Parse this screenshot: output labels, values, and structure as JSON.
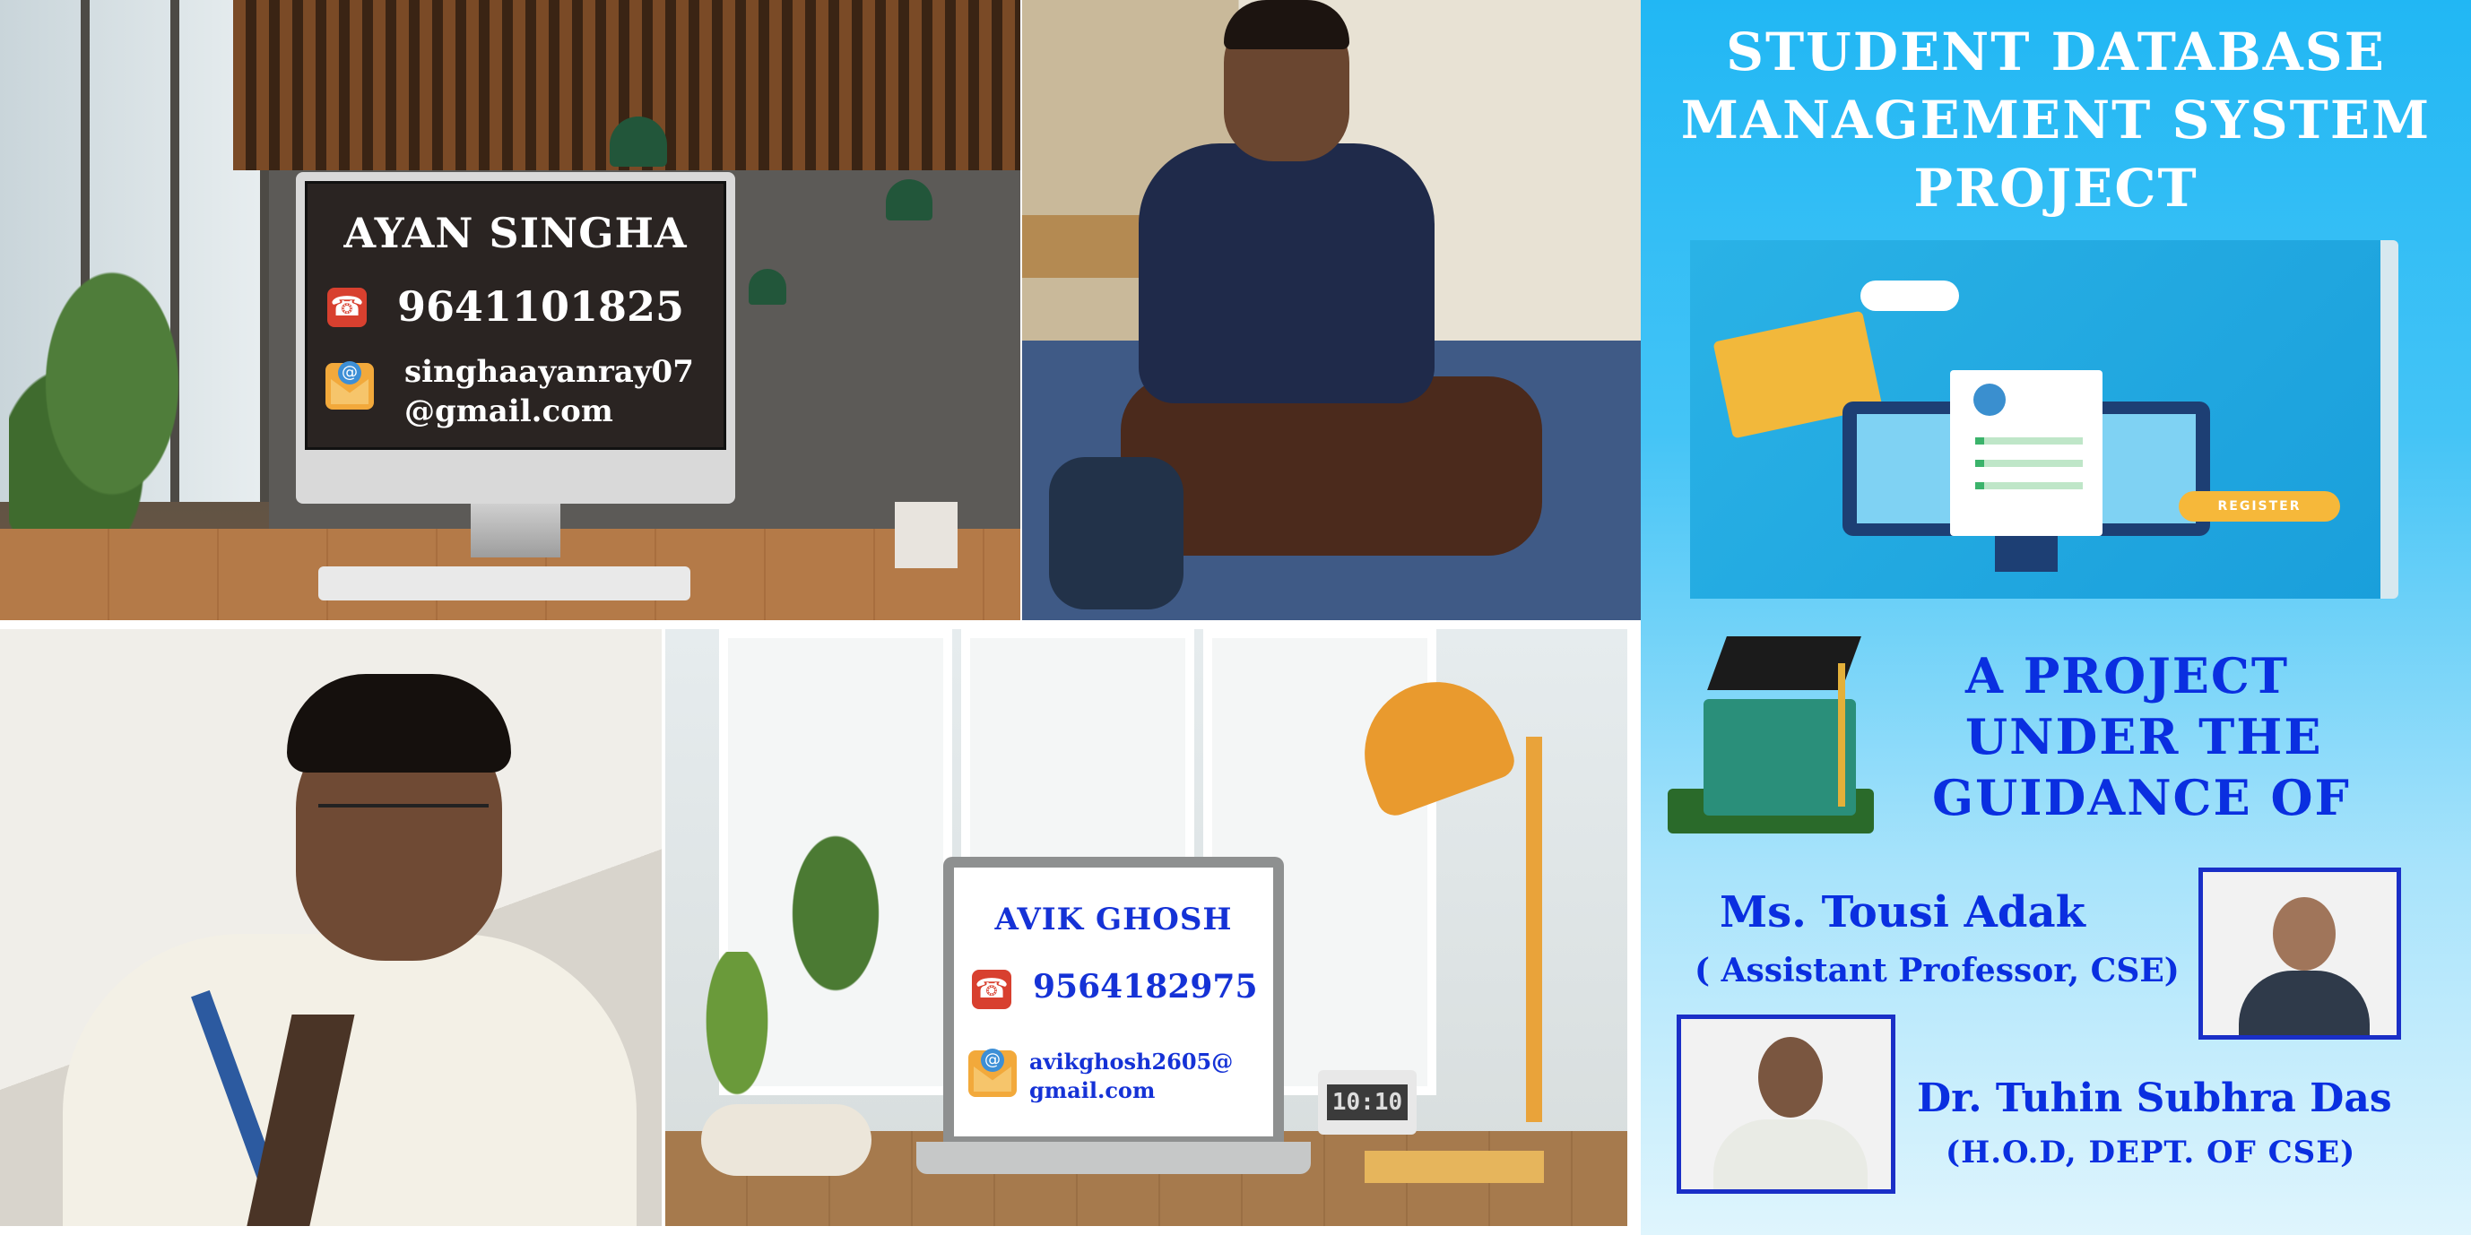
{
  "cards": {
    "ayan": {
      "name": "AYAN SINGHA",
      "phone": "9641101825",
      "email_line1": "singhaayanray07",
      "email_line2": "@gmail.com"
    },
    "avik": {
      "name": "AVIK  GHOSH",
      "phone": "9564182975",
      "email_line1": "avikghosh2605@",
      "email_line2": "gmail.com"
    }
  },
  "clock_text": "10:10",
  "project": {
    "title_line1": "STUDENT  DATABASE",
    "title_line2": "MANAGEMENT  SYSTEM",
    "title_line3": "PROJECT",
    "register_label": "REGISTER",
    "guidance_line1": "A PROJECT",
    "guidance_line2": "UNDER  THE",
    "guidance_line3": "GUIDANCE  OF"
  },
  "guides": [
    {
      "name": "Ms. Tousi Adak",
      "role": "( Assistant Professor, CSE)"
    },
    {
      "name": "Dr. Tuhin Subhra Das",
      "role": "(H.O.D,  DEPT.  OF  CSE)"
    }
  ],
  "colors": {
    "background_blue": "#21b7f4",
    "guidance_text": "#0a2fe0",
    "card_bg": "#2a2422"
  }
}
